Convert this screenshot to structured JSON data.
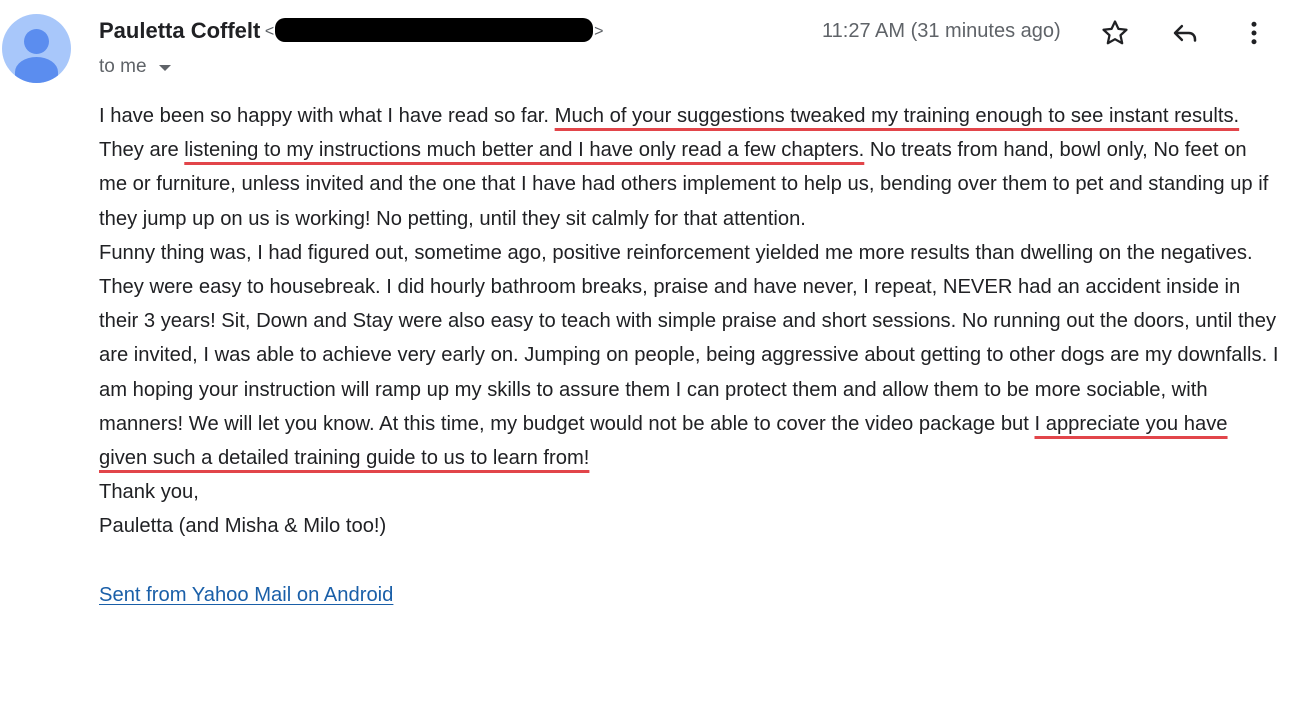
{
  "sender": {
    "name": "Pauletta Coffelt",
    "email_open": "<",
    "email_close": ">"
  },
  "recipient": {
    "label": "to me"
  },
  "timestamp": "11:27 AM (31 minutes ago)",
  "icons": {
    "star": "star-icon",
    "reply": "reply-icon",
    "more": "more-vert-icon"
  },
  "colors": {
    "highlight_underline": "#e2454a",
    "link": "#1a5fa8",
    "avatar_bg": "#a8c7fa",
    "avatar_fg": "#5b8def"
  },
  "body": {
    "p1_a": "I have been so happy with what I have read so far.  ",
    "p1_hl1": "Much of your suggestions tweaked my training enough to see instant results.",
    "p1_b": "  They are ",
    "p1_hl2": "listening to my instructions much better and I have only read a few chapters.",
    "p1_c": "  No treats from hand, bowl only, No feet on me or furniture, unless invited and the one that I have had others implement to help us, bending over them to pet and standing up if they jump up on us is working!  No petting, until they sit calmly for that attention.",
    "p2_a": "Funny thing was, I had figured out, sometime ago, positive reinforcement yielded me more results than dwelling on the negatives.  They were easy to housebreak.  I did hourly bathroom breaks, praise and have never, I repeat, NEVER had an accident inside in their 3 years!  Sit, Down and Stay were also easy to teach with simple praise and short sessions.  No running out the doors, until they are invited, I was able to achieve very early on.  Jumping on people, being aggressive about getting to other dogs are my downfalls. I am hoping your instruction will ramp up my skills to assure them I can protect them and allow them to be more sociable, with manners!  We will let you know.  At this time, my budget would not be able to cover the video package but ",
    "p2_hl": "I appreciate you have given such a detailed training guide to us to learn from!",
    "thanks": "Thank you,",
    "signature": "Pauletta (and Misha & Milo too!)",
    "sent_from": "Sent from Yahoo Mail on Android"
  }
}
